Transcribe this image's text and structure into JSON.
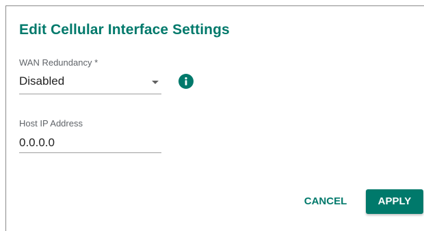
{
  "dialog": {
    "title": "Edit Cellular Interface Settings"
  },
  "wan_redundancy": {
    "label": "WAN Redundancy *",
    "value": "Disabled",
    "info_icon": "info-icon"
  },
  "host_ip": {
    "label": "Host IP Address",
    "value": "0.0.0.0"
  },
  "actions": {
    "cancel_label": "CANCEL",
    "apply_label": "APPLY"
  },
  "colors": {
    "accent": "#00796b",
    "text": "#212121",
    "label": "#5f6368"
  }
}
